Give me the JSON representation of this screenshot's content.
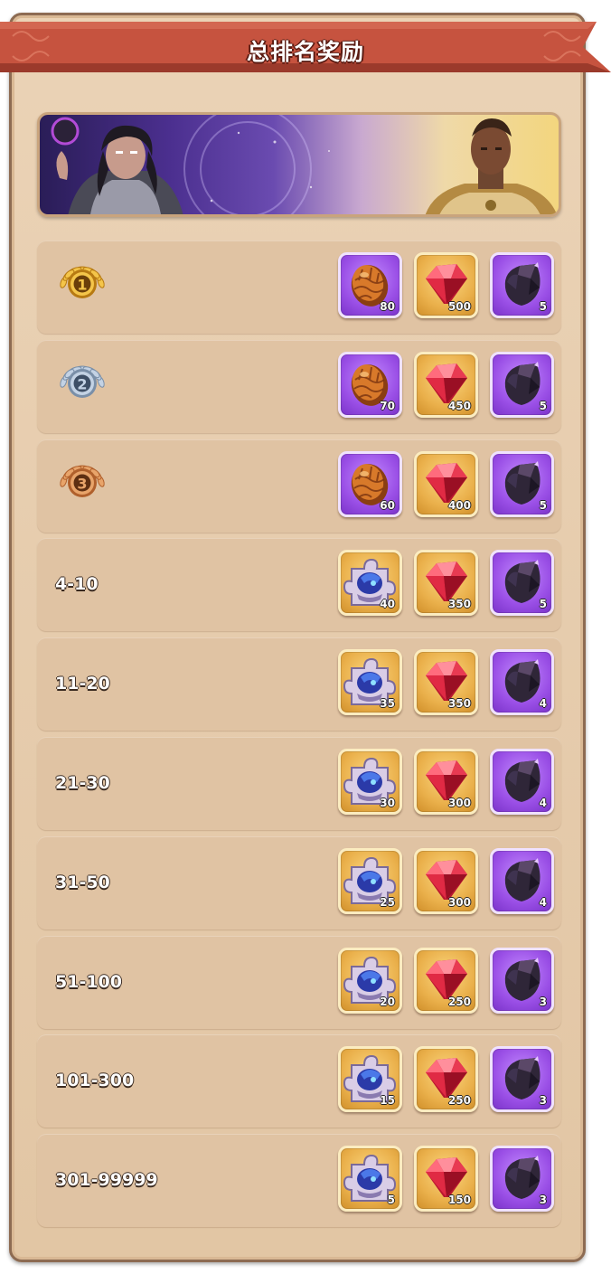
{
  "title": "总排名奖励",
  "colors": {
    "ribbon": "#c6533f",
    "panel": "#e6ccad",
    "row": "#e0c3a3",
    "gold_frame": "#eab04b",
    "purple_frame": "#9a4fe6"
  },
  "rows": [
    {
      "rank_label": "",
      "medal": "gold-medal-1",
      "items": [
        {
          "icon": "dragon-egg-icon",
          "frame": "purple",
          "qty": "80"
        },
        {
          "icon": "ruby-gem-icon",
          "frame": "gold",
          "qty": "500"
        },
        {
          "icon": "dark-crystal-icon",
          "frame": "purple",
          "qty": "5"
        }
      ]
    },
    {
      "rank_label": "",
      "medal": "silver-medal-2",
      "items": [
        {
          "icon": "dragon-egg-icon",
          "frame": "purple",
          "qty": "70"
        },
        {
          "icon": "ruby-gem-icon",
          "frame": "gold",
          "qty": "450"
        },
        {
          "icon": "dark-crystal-icon",
          "frame": "purple",
          "qty": "5"
        }
      ]
    },
    {
      "rank_label": "",
      "medal": "bronze-medal-3",
      "items": [
        {
          "icon": "dragon-egg-icon",
          "frame": "purple",
          "qty": "60"
        },
        {
          "icon": "ruby-gem-icon",
          "frame": "gold",
          "qty": "400"
        },
        {
          "icon": "dark-crystal-icon",
          "frame": "purple",
          "qty": "5"
        }
      ]
    },
    {
      "rank_label": "4-10",
      "items": [
        {
          "icon": "puzzle-piece-icon",
          "frame": "gold",
          "qty": "40"
        },
        {
          "icon": "ruby-gem-icon",
          "frame": "gold",
          "qty": "350"
        },
        {
          "icon": "dark-crystal-icon",
          "frame": "purple",
          "qty": "5"
        }
      ]
    },
    {
      "rank_label": "11-20",
      "items": [
        {
          "icon": "puzzle-piece-icon",
          "frame": "gold",
          "qty": "35"
        },
        {
          "icon": "ruby-gem-icon",
          "frame": "gold",
          "qty": "350"
        },
        {
          "icon": "dark-crystal-icon",
          "frame": "purple",
          "qty": "4"
        }
      ]
    },
    {
      "rank_label": "21-30",
      "items": [
        {
          "icon": "puzzle-piece-icon",
          "frame": "gold",
          "qty": "30"
        },
        {
          "icon": "ruby-gem-icon",
          "frame": "gold",
          "qty": "300"
        },
        {
          "icon": "dark-crystal-icon",
          "frame": "purple",
          "qty": "4"
        }
      ]
    },
    {
      "rank_label": "31-50",
      "items": [
        {
          "icon": "puzzle-piece-icon",
          "frame": "gold",
          "qty": "25"
        },
        {
          "icon": "ruby-gem-icon",
          "frame": "gold",
          "qty": "300"
        },
        {
          "icon": "dark-crystal-icon",
          "frame": "purple",
          "qty": "4"
        }
      ]
    },
    {
      "rank_label": "51-100",
      "items": [
        {
          "icon": "puzzle-piece-icon",
          "frame": "gold",
          "qty": "20"
        },
        {
          "icon": "ruby-gem-icon",
          "frame": "gold",
          "qty": "250"
        },
        {
          "icon": "dark-crystal-icon",
          "frame": "purple",
          "qty": "3"
        }
      ]
    },
    {
      "rank_label": "101-300",
      "items": [
        {
          "icon": "puzzle-piece-icon",
          "frame": "gold",
          "qty": "15"
        },
        {
          "icon": "ruby-gem-icon",
          "frame": "gold",
          "qty": "250"
        },
        {
          "icon": "dark-crystal-icon",
          "frame": "purple",
          "qty": "3"
        }
      ]
    },
    {
      "rank_label": "301-99999",
      "items": [
        {
          "icon": "puzzle-piece-icon",
          "frame": "gold",
          "qty": "5"
        },
        {
          "icon": "ruby-gem-icon",
          "frame": "gold",
          "qty": "150"
        },
        {
          "icon": "dark-crystal-icon",
          "frame": "purple",
          "qty": "3"
        }
      ]
    }
  ]
}
